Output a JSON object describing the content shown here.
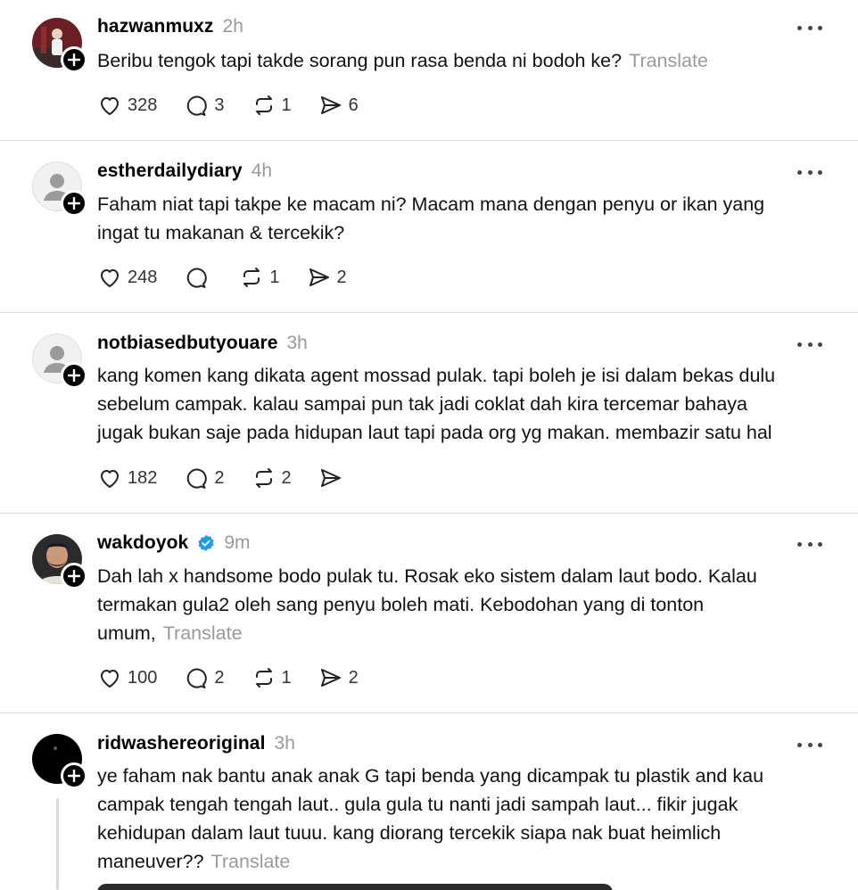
{
  "posts": [
    {
      "username": "hazwanmuxz",
      "time": "2h",
      "text_lines": [
        "Beribu tengok tapi takde sorang pun rasa benda ni bodoh ke?"
      ],
      "translate": "Translate",
      "likes": "328",
      "replies": "3",
      "reposts": "1",
      "shares": "6",
      "avatar": "photo-avatar"
    },
    {
      "username": "estherdailydiary",
      "time": "4h",
      "text_lines": [
        "Faham niat tapi takpe ke macam ni? Macam mana dengan penyu or ikan yang",
        "ingat tu makanan & tercekik?"
      ],
      "likes": "248",
      "replies": "",
      "reposts": "1",
      "shares": "2",
      "avatar": "default-avatar"
    },
    {
      "username": "notbiasedbutyouare",
      "time": "3h",
      "text_lines": [
        "kang komen kang dikata agent mossad pulak. tapi boleh je isi dalam bekas dulu",
        "sebelum campak. kalau sampai pun tak jadi coklat dah kira tercemar bahaya",
        "jugak bukan saje pada hidupan laut tapi pada org yg makan. membazir satu hal"
      ],
      "likes": "182",
      "replies": "2",
      "reposts": "2",
      "shares": "",
      "avatar": "default-avatar"
    },
    {
      "username": "wakdoyok",
      "verified": true,
      "time": "9m",
      "text_lines": [
        "Dah lah x handsome bodo pulak tu. Rosak eko sistem dalam laut bodo. Kalau",
        "termakan gula2 oleh sang penyu boleh mati. Kebodohan yang di tonton",
        "umum,"
      ],
      "translate": "Translate",
      "likes": "100",
      "replies": "2",
      "reposts": "1",
      "shares": "2",
      "avatar": "photo-avatar"
    },
    {
      "username": "ridwashereoriginal",
      "time": "3h",
      "text_lines": [
        "ye faham nak bantu anak anak G tapi benda yang dicampak tu plastik and kau",
        "campak tengah tengah laut.. gula gula tu nanti jadi sampah laut... fikir jugak",
        "kehidupan dalam laut tuuu. kang diorang tercekik siapa nak buat heimlich",
        "maneuver??"
      ],
      "translate": "Translate",
      "avatar": "black-avatar"
    }
  ],
  "colors": {
    "muted": "#9a9a9a",
    "divider": "#dcdcdc",
    "verified": "#1d9bf0"
  }
}
